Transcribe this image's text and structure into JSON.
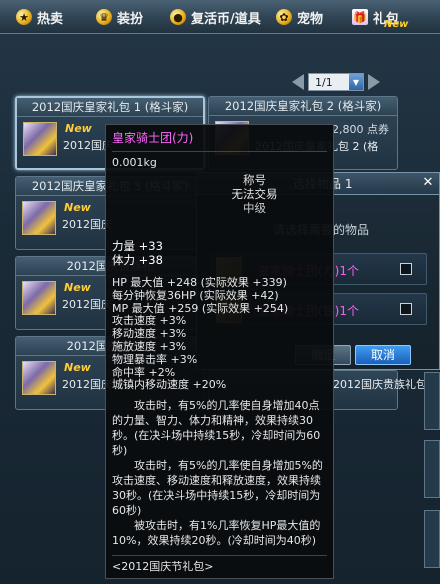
{
  "tabs": [
    {
      "label": "热卖",
      "icon": "star-icon"
    },
    {
      "label": "装扮",
      "icon": "trophy-icon"
    },
    {
      "label": "复活币/道具",
      "icon": "coin-icon"
    },
    {
      "label": "宠物",
      "icon": "paw-icon"
    },
    {
      "label": "礼包",
      "icon": "gift-icon",
      "badge": "New"
    }
  ],
  "pager": {
    "value": "1/1"
  },
  "cards": [
    {
      "title": "2012国庆皇家礼包 1 (格斗家)",
      "new": "New",
      "sub": "2012国庆",
      "price": ""
    },
    {
      "title": "2012国庆皇家礼包 2 (格斗家)",
      "new": "",
      "sub": "2012国庆皇家礼包 2 (格",
      "price": "2,800 点券"
    },
    {
      "title": "2012国庆皇家礼包 3 (格斗家)",
      "new": "New",
      "sub": "2012国庆",
      "price": ""
    },
    {
      "title": "2012国庆贵族礼",
      "new": "New",
      "sub": "2012国庆",
      "price": ""
    },
    {
      "title": "2012国庆贵族礼",
      "new": "New",
      "sub": "2012国庆",
      "price": ""
    },
    {
      "title": "",
      "new": "",
      "sub": "2012国庆贵族礼包 4 (格...",
      "price": ""
    }
  ],
  "dialog": {
    "title": "选择物品 1",
    "hint": "请选择需要的物品",
    "options": [
      "皇家骑士团(力)1个",
      "皇家骑士团(智)1个"
    ],
    "ok": "确定",
    "cancel": "取消"
  },
  "tooltip": {
    "name": "皇家骑士团(力)",
    "weight": "0.001kg",
    "rights": [
      "称号",
      "无法交易"
    ],
    "level": "中级",
    "stats": [
      "力量 +33",
      "体力 +38"
    ],
    "lines": [
      "HP 最大值 +248 (实际效果 +339)",
      "每分钟恢复36HP (实际效果 +42)",
      "MP 最大值 +259 (实际效果 +254)",
      "攻击速度 +3%",
      "移动速度 +3%",
      "施放速度 +3%",
      "物理暴击率 +3%",
      "命中率 +2%",
      "城镇内移动速度 +20%"
    ],
    "desc": [
      "攻击时，有5%的几率使自身增加40点的力量、智力、体力和精神，效果持续30秒。(在决斗场中持续15秒，冷却时间为60秒)",
      "攻击时，有5%的几率使自身增加5%的攻击速度、移动速度和释放速度，效果持续30秒。(在决斗场中持续15秒，冷却时间为60秒)",
      "被攻击时，有1%几率恢复HP最大值的10%，效果持续20秒。(冷却时间为40秒)"
    ],
    "footer": "<2012国庆节礼包>"
  }
}
